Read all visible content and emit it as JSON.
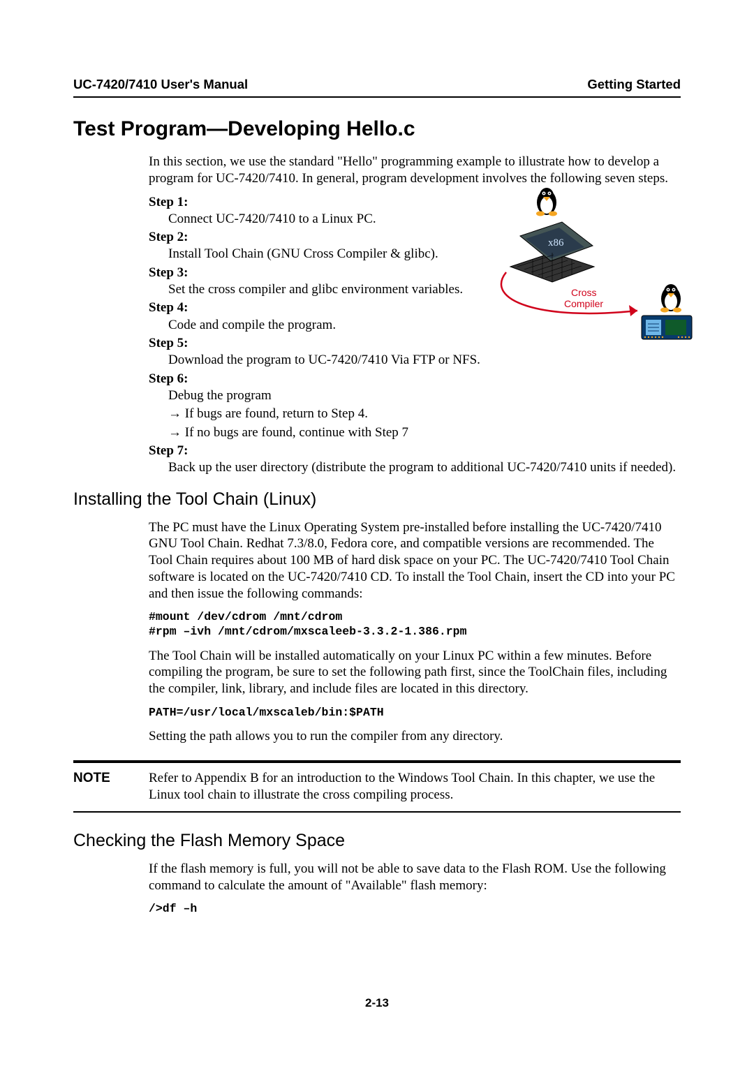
{
  "header": {
    "left": "UC-7420/7410 User's Manual",
    "right": "Getting Started"
  },
  "h1": "Test Program―Developing Hello.c",
  "intro": "In this section, we use the standard \"Hello\" programming example to illustrate how to develop a program for UC-7420/7410. In general, program development involves the following seven steps.",
  "steps": [
    {
      "label": "Step 1:",
      "lines": [
        "Connect UC-7420/7410 to a Linux PC."
      ]
    },
    {
      "label": "Step 2:",
      "lines": [
        "Install Tool Chain (GNU Cross Compiler & glibc)."
      ]
    },
    {
      "label": "Step 3:",
      "lines": [
        "Set the cross compiler and glibc environment variables."
      ]
    },
    {
      "label": "Step 4:",
      "lines": [
        "Code and compile the program."
      ]
    },
    {
      "label": "Step 5:",
      "lines": [
        "Download the program to UC-7420/7410 Via FTP or NFS."
      ]
    },
    {
      "label": "Step 6:",
      "lines": [
        "Debug the program",
        "→ If bugs are found, return to Step 4.",
        "→ If no bugs are found, continue with Step 7"
      ]
    },
    {
      "label": "Step 7:",
      "lines": [
        "Back up the user directory (distribute the program to additional UC-7420/7410 units if needed)."
      ]
    }
  ],
  "diagram": {
    "x86": "x86",
    "cross": "Cross",
    "compiler": "Compiler"
  },
  "section1": {
    "title": "Installing the Tool Chain (Linux)",
    "p1": "The PC must have the Linux Operating System pre-installed before installing the UC-7420/7410 GNU Tool Chain. Redhat 7.3/8.0, Fedora core, and compatible versions are recommended. The Tool Chain requires about 100 MB of hard disk space on your PC. The UC-7420/7410 Tool Chain software is located on the UC-7420/7410 CD. To install the Tool Chain, insert the CD into your PC and then issue the following commands:",
    "code1": "#mount /dev/cdrom /mnt/cdrom\n#rpm –ivh /mnt/cdrom/mxscaleeb-3.3.2-1.386.rpm",
    "p2": "The Tool Chain will be installed automatically on your Linux PC within a few minutes. Before compiling the program, be sure to set the following path first, since the ToolChain files, including the compiler, link, library, and include files are located in this directory.",
    "code2": "PATH=/usr/local/mxscaleb/bin:$PATH",
    "p3": "Setting the path allows you to run the compiler from any directory."
  },
  "note": {
    "label": "NOTE",
    "text": "Refer to Appendix B for an introduction to the Windows Tool Chain. In this chapter, we use the Linux tool chain to illustrate the cross compiling process."
  },
  "section2": {
    "title": "Checking the Flash Memory Space",
    "p1": "If the flash memory is full, you will not be able to save data to the Flash ROM. Use the following command to calculate the amount of \"Available\" flash memory:",
    "code1": "/>df –h"
  },
  "pageNumber": "2-13"
}
